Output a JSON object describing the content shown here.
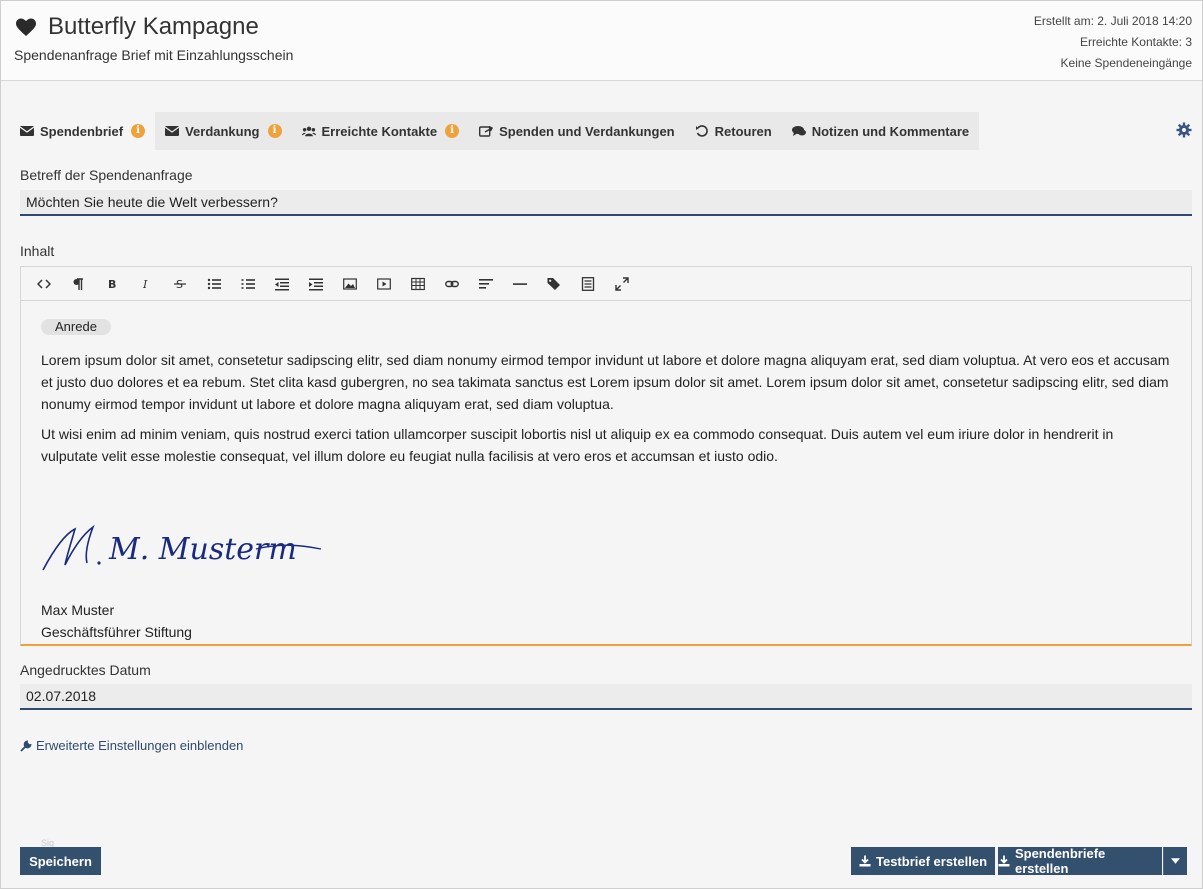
{
  "header": {
    "title": "Butterfly Kampagne",
    "subtitle": "Spendenanfrage Brief mit Einzahlungsschein",
    "meta": [
      "Erstellt am: 2. Juli 2018 14:20",
      "Erreichte Kontakte: 3",
      "Keine Spendeneingänge"
    ]
  },
  "tabs": [
    {
      "label": "Spendenbrief",
      "icon": "envelope-icon",
      "info": "i"
    },
    {
      "label": "Verdankung",
      "icon": "envelope-icon",
      "info": "i"
    },
    {
      "label": "Erreichte Kontakte",
      "icon": "users-icon",
      "info": "i"
    },
    {
      "label": "Spenden und Verdankungen",
      "icon": "share-icon"
    },
    {
      "label": "Retouren",
      "icon": "undo-icon"
    },
    {
      "label": "Notizen und Kommentare",
      "icon": "comments-icon"
    }
  ],
  "form": {
    "subject_label": "Betreff der Spendenanfrage",
    "subject_value": "Möchten Sie heute die Welt verbessern?",
    "content_label": "Inhalt",
    "date_label": "Angedrucktes Datum",
    "date_value": "02.07.2018"
  },
  "editor": {
    "toolbar": [
      "code-icon",
      "paragraph-icon",
      "bold-icon",
      "italic-icon",
      "strikethrough-icon",
      "unordered-list-icon",
      "ordered-list-icon",
      "outdent-icon",
      "indent-icon",
      "image-icon",
      "video-icon",
      "table-icon",
      "link-icon",
      "align-icon",
      "horizontal-rule-icon",
      "tags-icon",
      "template-icon",
      "fullscreen-icon"
    ],
    "placeholder_pill": "Anrede",
    "paragraph1": "Lorem ipsum dolor sit amet, consetetur sadipscing elitr, sed diam nonumy eirmod tempor invidunt ut labore et dolore magna aliquyam erat, sed diam voluptua. At vero eos et accusam et justo duo dolores et ea rebum. Stet clita kasd gubergren, no sea takimata sanctus est Lorem ipsum dolor sit amet. Lorem ipsum dolor sit amet, consetetur sadipscing elitr, sed diam nonumy eirmod tempor invidunt ut labore et dolore magna aliquyam erat, sed diam voluptua.",
    "paragraph2": "Ut wisi enim ad minim veniam, quis nostrud exerci tation ullamcorper suscipit lobortis nisl ut aliquip ex ea commodo consequat. Duis autem vel eum iriure dolor in hendrerit in vulputate velit esse molestie consequat, vel illum dolore eu feugiat nulla facilisis at vero eros et accumsan et iusto odio.",
    "signature_text": "M. Musterm",
    "sig_name": "Max Muster",
    "sig_role": "Geschäftsführer Stiftung"
  },
  "advanced_link": "Erweiterte Einstellungen einblenden",
  "buttons": {
    "save": "Speichern",
    "ghost_text": "Sig",
    "test_letter": "Testbrief erstellen",
    "create_letters": "Spendenbriefe erstellen"
  },
  "colors": {
    "accent": "#34506f",
    "info": "#f0a23a",
    "input_line": "#2f4a6e"
  }
}
